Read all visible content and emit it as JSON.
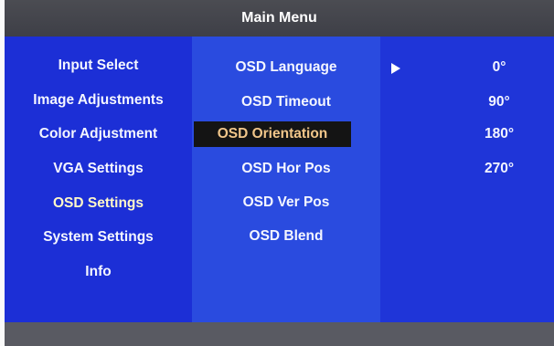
{
  "window": {
    "title": "Main Menu"
  },
  "left_menu": [
    {
      "label": "Input Select"
    },
    {
      "label": "Image Adjustments"
    },
    {
      "label": "Color Adjustment"
    },
    {
      "label": "VGA Settings"
    },
    {
      "label": "OSD Settings"
    },
    {
      "label": "System Settings"
    },
    {
      "label": "Info"
    }
  ],
  "osd_menu": [
    {
      "label": "OSD Language"
    },
    {
      "label": "OSD Timeout"
    },
    {
      "label": "OSD Orientation"
    },
    {
      "label": "OSD Hor Pos"
    },
    {
      "label": "OSD Ver Pos"
    },
    {
      "label": "OSD Blend"
    }
  ],
  "orientation_options": [
    {
      "label": "0°"
    },
    {
      "label": "90°"
    },
    {
      "label": "180°"
    },
    {
      "label": "270°"
    }
  ],
  "arrow_icon": "play-arrow-icon",
  "colors": {
    "title_bar": "#414249",
    "left_panel": "#1c2fd6",
    "middle_panel": "#2a4bdf",
    "right_panel": "#1f35d8",
    "highlight_background": "#141414",
    "highlight_text": "#f1c68a",
    "active_section_text": "#fff8c8"
  }
}
